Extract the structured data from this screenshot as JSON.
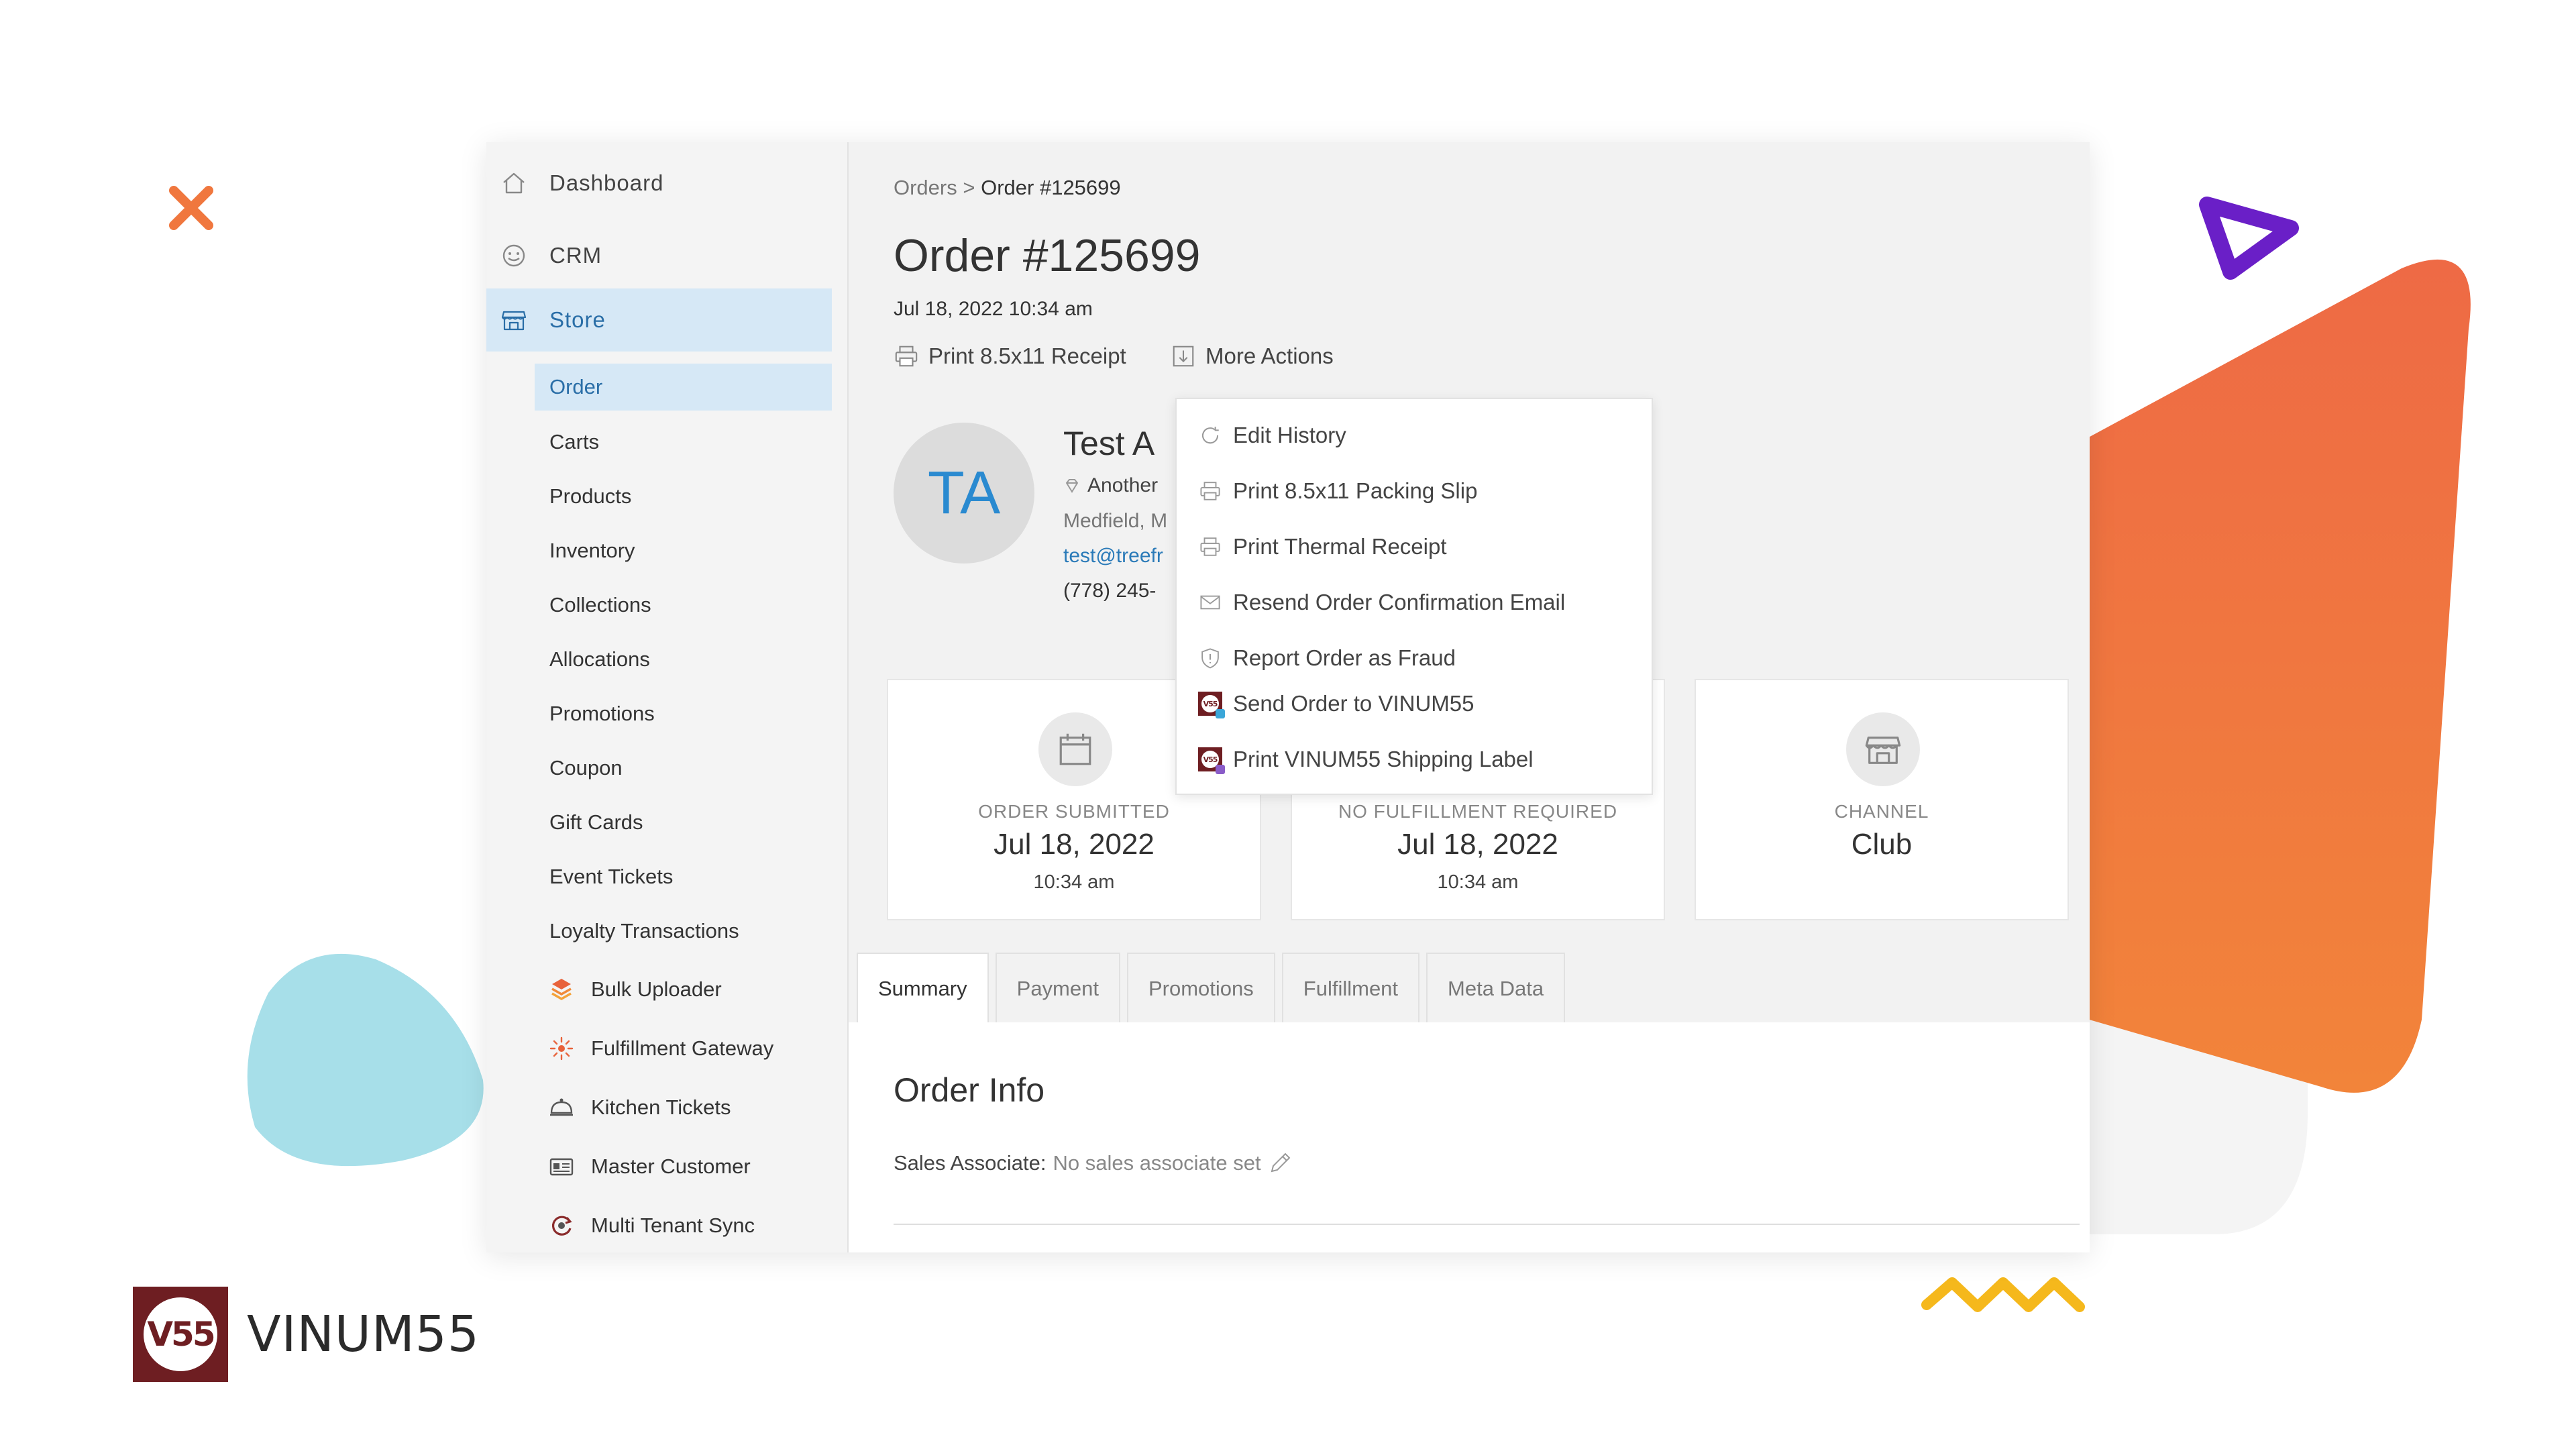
{
  "brand": {
    "name": "VINUM55",
    "mark": "V55"
  },
  "colors": {
    "accent": "#2a6ea7",
    "active_bg": "#d6e8f6",
    "brand": "#6e1e22",
    "orange": "#f0773e",
    "purple": "#6a1fc7"
  },
  "sidebar": {
    "top_items": [
      {
        "label": "Dashboard",
        "icon": "home-icon"
      },
      {
        "label": "CRM",
        "icon": "smiley-icon"
      },
      {
        "label": "Store",
        "icon": "storefront-icon",
        "active": true
      }
    ],
    "store_items": [
      {
        "label": "Order",
        "active": true
      },
      {
        "label": "Carts"
      },
      {
        "label": "Products"
      },
      {
        "label": "Inventory"
      },
      {
        "label": "Collections"
      },
      {
        "label": "Allocations"
      },
      {
        "label": "Promotions"
      },
      {
        "label": "Coupon"
      },
      {
        "label": "Gift Cards"
      },
      {
        "label": "Event Tickets"
      },
      {
        "label": "Loyalty Transactions"
      }
    ],
    "tools": [
      {
        "label": "Bulk Uploader",
        "icon": "layers-icon"
      },
      {
        "label": "Fulfillment Gateway",
        "icon": "gateway-icon"
      },
      {
        "label": "Kitchen Tickets",
        "icon": "cloche-icon"
      },
      {
        "label": "Master Customer",
        "icon": "id-card-icon"
      },
      {
        "label": "Multi Tenant Sync",
        "icon": "sync-icon"
      }
    ]
  },
  "breadcrumb": {
    "root": "Orders",
    "separator": ">",
    "current": "Order #125699"
  },
  "order": {
    "title": "Order #125699",
    "date": "Jul 18, 2022 10:34 am",
    "actions": {
      "print_receipt": "Print 8.5x11 Receipt",
      "more_actions": "More Actions"
    }
  },
  "customer": {
    "initials": "TA",
    "name": "Test A",
    "address1": "Another",
    "address2": "Medfield, M",
    "email": "test@treefr",
    "phone": "(778) 245-"
  },
  "more_actions_menu": [
    {
      "label": "Edit History",
      "icon": "history-icon"
    },
    {
      "label": "Print 8.5x11 Packing Slip",
      "icon": "printer-icon"
    },
    {
      "label": "Print Thermal Receipt",
      "icon": "printer-icon"
    },
    {
      "label": "Resend Order Confirmation Email",
      "icon": "envelope-icon"
    },
    {
      "label": "Report Order as Fraud",
      "icon": "shield-icon"
    },
    {
      "label": "Send Order to VINUM55",
      "icon": "vinum55-logo-icon"
    },
    {
      "label": "Print VINUM55 Shipping Label",
      "icon": "vinum55-logo-icon"
    }
  ],
  "cards": [
    {
      "label": "ORDER SUBMITTED",
      "value": "Jul 18, 2022",
      "sub": "10:34 am",
      "icon": "calendar-icon"
    },
    {
      "label": "NO FULFILLMENT REQUIRED",
      "value": "Jul 18, 2022",
      "sub": "10:34 am",
      "icon": "truck-icon"
    },
    {
      "label": "CHANNEL",
      "value": "Club",
      "sub": "",
      "icon": "storefront-icon"
    }
  ],
  "tabs": [
    {
      "label": "Summary",
      "active": true
    },
    {
      "label": "Payment"
    },
    {
      "label": "Promotions"
    },
    {
      "label": "Fulfillment"
    },
    {
      "label": "Meta Data"
    }
  ],
  "order_info": {
    "title": "Order Info",
    "sales_associate_label": "Sales Associate:",
    "sales_associate_value": "No sales associate set"
  }
}
